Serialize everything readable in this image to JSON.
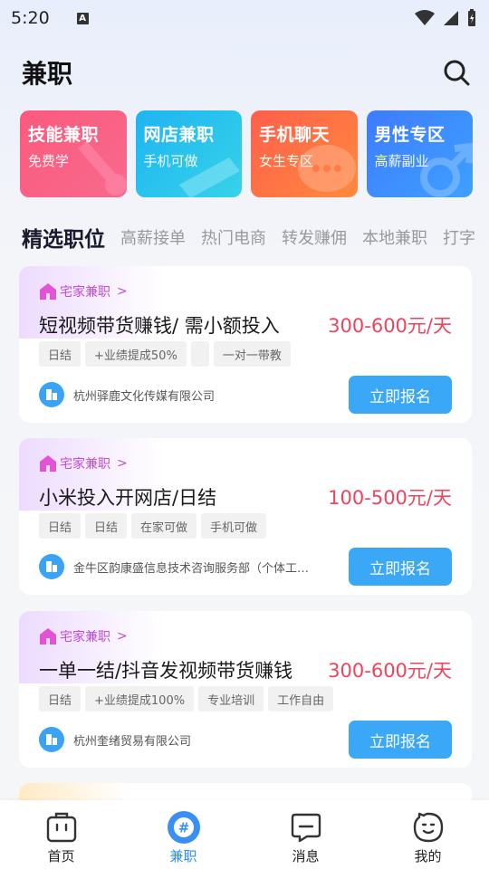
{
  "status": {
    "time": "5:20",
    "indicator": "A"
  },
  "header": {
    "title": "兼职"
  },
  "categories": [
    {
      "title": "技能兼职",
      "subtitle": "免费学",
      "icon": "wrench-icon",
      "color": "#fb5a7e"
    },
    {
      "title": "网店兼职",
      "subtitle": "手机可做",
      "icon": "pen-icon",
      "color": "#1fb4f2"
    },
    {
      "title": "手机聊天",
      "subtitle": "女生专区",
      "icon": "chat-icon",
      "color": "#ff6a46"
    },
    {
      "title": "男性专区",
      "subtitle": "高薪副业",
      "icon": "male-icon",
      "color": "#3d7bff"
    }
  ],
  "tabs": [
    "精选职位",
    "高薪接单",
    "热门电商",
    "转发赚佣",
    "本地兼职",
    "打字"
  ],
  "jobs": [
    {
      "category": "宅家兼职",
      "title": "短视频带货赚钱/ 需小额投入",
      "salary": "300-600元/天",
      "tags": [
        "日结",
        "+业绩提成50%",
        "",
        "一对一带教"
      ],
      "company": "杭州驿鹿文化传媒有限公司",
      "apply": "立即报名"
    },
    {
      "category": "宅家兼职",
      "title": "小米投入开网店/日结",
      "salary": "100-500元/天",
      "tags": [
        "日结",
        "日结",
        "在家可做",
        "手机可做"
      ],
      "company": "金牛区韵康盛信息技术咨询服务部（个体工商户）",
      "apply": "立即报名"
    },
    {
      "category": "宅家兼职",
      "title": "一单一结/抖音发视频带货赚钱",
      "salary": "300-600元/天",
      "tags": [
        "日结",
        "+业绩提成100%",
        "专业培训",
        "工作自由"
      ],
      "company": "杭州奎绪贸易有限公司",
      "apply": "立即报名"
    }
  ],
  "nav": [
    {
      "label": "首页",
      "icon": "home-bag-icon",
      "active": false
    },
    {
      "label": "兼职",
      "icon": "hash-icon",
      "active": true
    },
    {
      "label": "消息",
      "icon": "message-icon",
      "active": false
    },
    {
      "label": "我的",
      "icon": "profile-face-icon",
      "active": false
    }
  ],
  "colors": {
    "accent": "#3aa8f7",
    "salary": "#f2435c",
    "category": "#c14bd8",
    "nav_active": "#2c8ef5"
  }
}
